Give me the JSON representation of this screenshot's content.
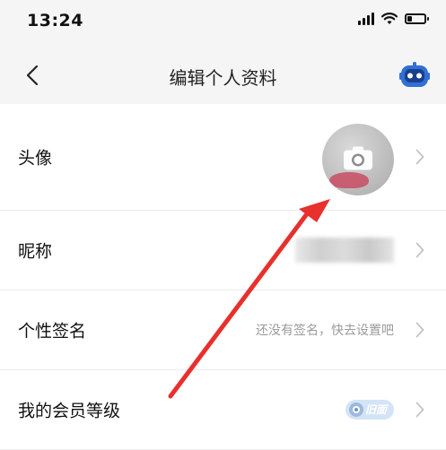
{
  "status_bar": {
    "time": "13:24",
    "battery_level": 0.25
  },
  "header": {
    "title": "编辑个人资料",
    "back_icon": "chevron-left-icon",
    "assistant_icon": "robot-icon"
  },
  "rows": [
    {
      "label": "头像"
    },
    {
      "label": "昵称"
    },
    {
      "label": "个性签名",
      "hint": "还没有签名，快去设置吧"
    },
    {
      "label": "我的会员等级",
      "badge": "旧面"
    }
  ],
  "colors": {
    "background": "#ffffff",
    "header_background": "#f5f5f5",
    "annotation_arrow": "#e8302c",
    "hint_text": "#9a9a9a"
  }
}
